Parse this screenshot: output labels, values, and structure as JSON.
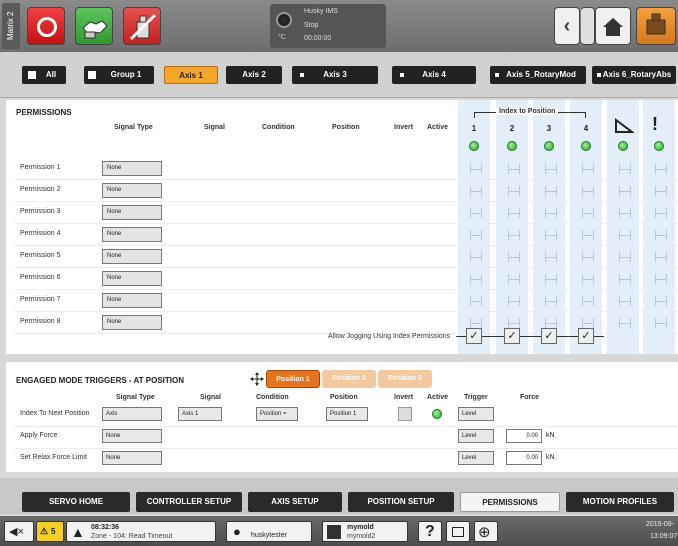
{
  "header": {
    "matrix_tab": "Matrix 2",
    "status_unit": "°C",
    "status_lines": [
      "Husky IMS",
      "Stop",
      "00:00:00"
    ]
  },
  "axis_tabs": [
    {
      "label": "All"
    },
    {
      "label": "Group 1"
    },
    {
      "label": "Axis 1"
    },
    {
      "label": "Axis 2"
    },
    {
      "label": "Axis 3"
    },
    {
      "label": "Axis 4"
    },
    {
      "label": "Axis 5_RotaryMod"
    },
    {
      "label": "Axis 6_RotaryAbs"
    }
  ],
  "permissions": {
    "title": "PERMISSIONS",
    "columns": [
      "Signal Type",
      "Signal",
      "Condition",
      "Position",
      "Invert",
      "Active"
    ],
    "index_title": "Index to Position",
    "index_numbers": [
      "1",
      "2",
      "3",
      "4"
    ],
    "rows": [
      {
        "label": "Permission 1",
        "signal_type": "None"
      },
      {
        "label": "Permission 2",
        "signal_type": "None"
      },
      {
        "label": "Permission 3",
        "signal_type": "None"
      },
      {
        "label": "Permission 4",
        "signal_type": "None"
      },
      {
        "label": "Permission 5",
        "signal_type": "None"
      },
      {
        "label": "Permission 6",
        "signal_type": "None"
      },
      {
        "label": "Permission 7",
        "signal_type": "None"
      },
      {
        "label": "Permission 8",
        "signal_type": "None"
      }
    ],
    "allow_jogging_label": "Allow Jogging Using Index Permissions",
    "exclaim": "!"
  },
  "engaged": {
    "title": "ENGAGED MODE TRIGGERS - AT POSITION",
    "position_tabs": [
      "Position 1",
      "Position 2",
      "Position 3"
    ],
    "columns": [
      "Signal Type",
      "Signal",
      "Condition",
      "Position",
      "Invert",
      "Active",
      "Trigger",
      "Force"
    ],
    "rows": [
      {
        "label": "Index To Next Position",
        "signal_type": "Axis",
        "signal": "Axis 1",
        "condition": "Position =",
        "position": "Position 1",
        "trigger": "Level"
      },
      {
        "label": "Apply Force",
        "signal_type": "None",
        "trigger": "Level",
        "force": "0.00",
        "unit": "kN"
      },
      {
        "label": "Set Relax Force Limit",
        "signal_type": "None",
        "trigger": "Level",
        "force": "0.00",
        "unit": "kN"
      }
    ]
  },
  "bottom_nav": [
    "SERVO HOME",
    "CONTROLLER SETUP",
    "AXIS SETUP",
    "POSITION SETUP",
    "PERMISSIONS",
    "MOTION PROFILES"
  ],
  "statusbar": {
    "time": "08:32:36",
    "alarm": "Zone - 104: Read Timeout",
    "user": "huskytester",
    "mold1": "mymold",
    "mold2": "mymold2",
    "date": "2015-09-",
    "clock": "13:09:07",
    "warn_count": "5"
  }
}
